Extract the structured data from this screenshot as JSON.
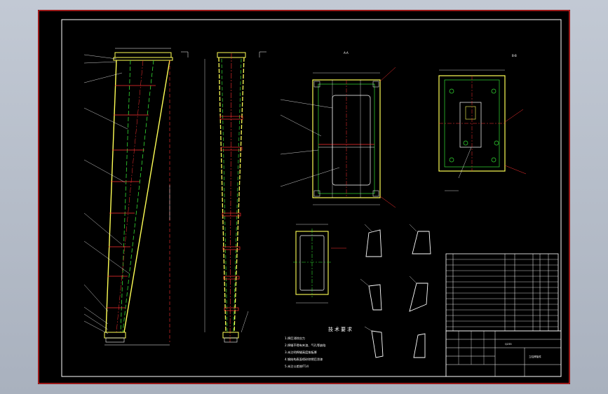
{
  "views": {
    "section_a": "A-A",
    "section_b": "B-B"
  },
  "notes": {
    "title": "技术要求",
    "items": [
      "1.焊后消除应力",
      "2.焊缝不得有夹渣、气孔等缺陷",
      "3.未注明焊缝高度按板厚",
      "4.钢结构表面喷砂除锈后涂漆",
      "5.未注公差按IT14"
    ]
  },
  "title_block": {
    "drawing_name": "立柱焊接件",
    "material": "Q235"
  },
  "colors": {
    "background": "#000000",
    "border": "#ffffff",
    "frame_red": "#ff2a2a",
    "outline_yellow": "#ffff55",
    "hidden_green": "#33dd33",
    "leader_red": "#ff3030"
  }
}
